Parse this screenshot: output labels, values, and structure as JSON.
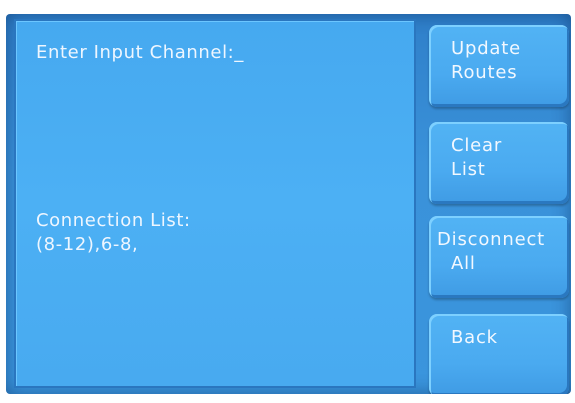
{
  "main": {
    "prompt": "Enter Input Channel:_",
    "connection_label": "Connection List:",
    "connection_value": "(8-12),6-8,"
  },
  "buttons": {
    "update": {
      "line1": "Update",
      "line2": "Routes"
    },
    "clear": {
      "line1": "Clear",
      "line2": "List"
    },
    "disconnect": {
      "line1": "Disconnect",
      "line2": "All"
    },
    "back": {
      "line1": "Back"
    }
  }
}
